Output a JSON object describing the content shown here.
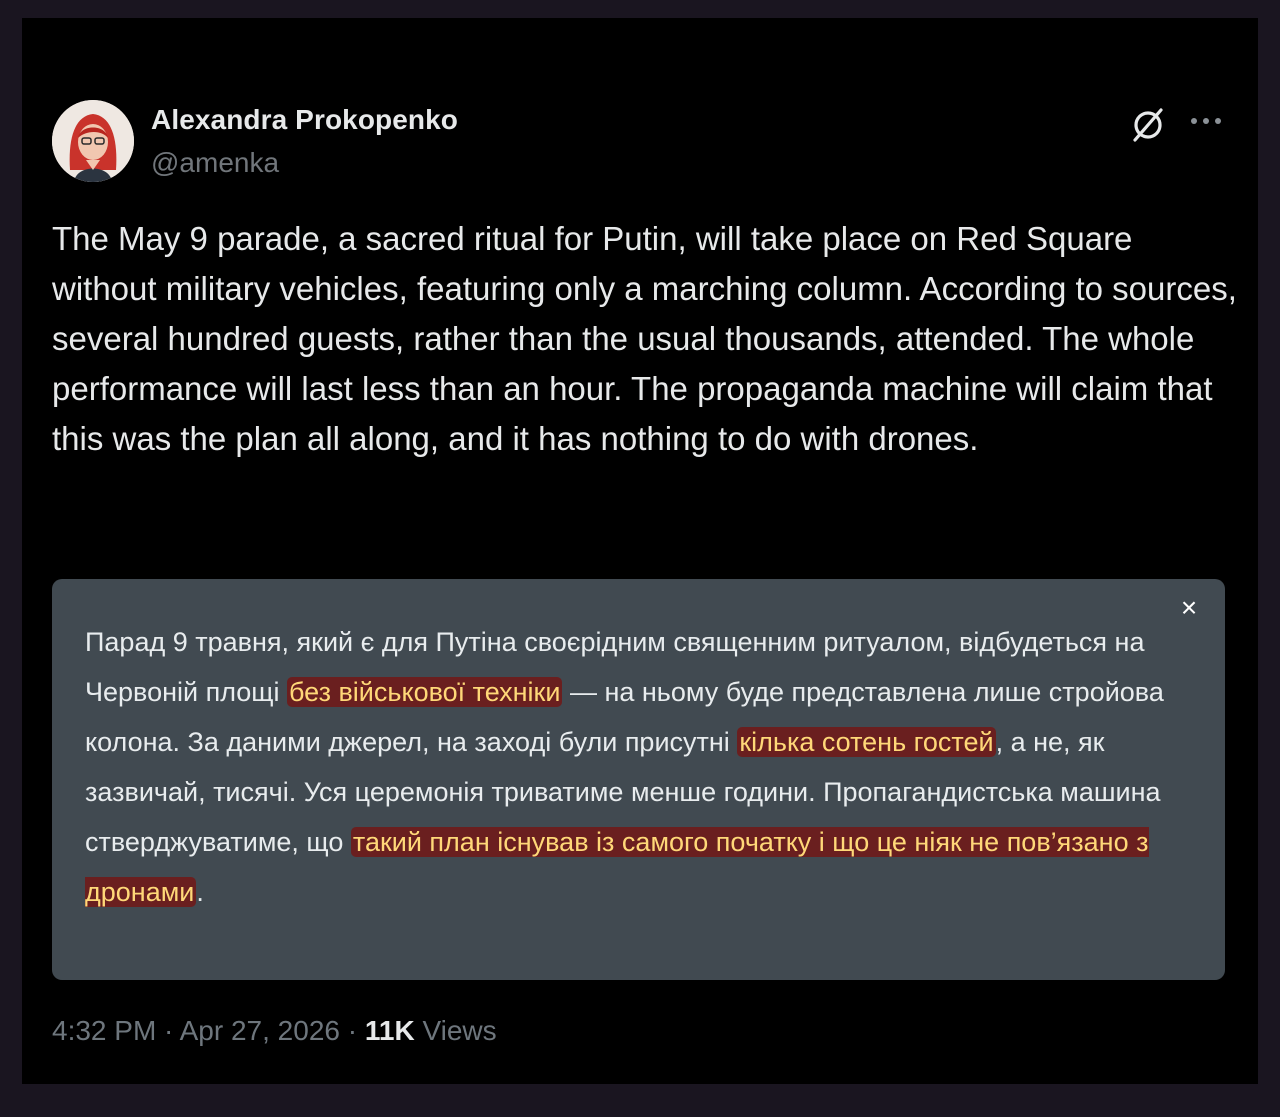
{
  "author": {
    "name": "Alexandra Prokopenko",
    "handle": "@amenka"
  },
  "icons": {
    "grok": "grok-icon",
    "more": "more-icon",
    "close": "close-icon"
  },
  "tweet": {
    "text": "The May 9 parade, a sacred ritual for Putin, will take place on Red Square without military vehicles, featuring only a marching column. According to sources, several hundred guests, rather than the usual thousands, attended. The whole performance will last less than an hour. The propaganda machine will claim that this was the plan all along, and it has nothing to do with drones."
  },
  "translation": {
    "close_label": "×",
    "segments": [
      {
        "text": "Парад 9 травня, який є для Путіна своєрідним священним ритуалом, відбудеться на Червоній площі ",
        "highlight": false
      },
      {
        "text": "без військової техніки",
        "highlight": true
      },
      {
        "text": " — на ньому буде представлена лише стройова колона. За даними джерел, на заході були присутні ",
        "highlight": false
      },
      {
        "text": "кілька сотень гостей",
        "highlight": true
      },
      {
        "text": ", а не, як зазвичай, тисячі. Уся церемонія триватиме менше години. Пропагандистська машина стверджуватиме, що ",
        "highlight": false
      },
      {
        "text": "такий план існував із самого початку і що це ніяк не пов’язано з дронами",
        "highlight": true
      },
      {
        "text": ".",
        "highlight": false
      }
    ]
  },
  "meta": {
    "time": "4:32 PM",
    "sep1": " · ",
    "date": "Apr 27, 2026",
    "sep2": " · ",
    "views_count": "11K",
    "views_label": " Views"
  },
  "colors": {
    "background": "#000000",
    "text": "#e7e9ea",
    "muted": "#71767b",
    "translation_bg": "#414a51",
    "highlight_bg": "#6a1f1f",
    "highlight_text": "#ffd878"
  }
}
